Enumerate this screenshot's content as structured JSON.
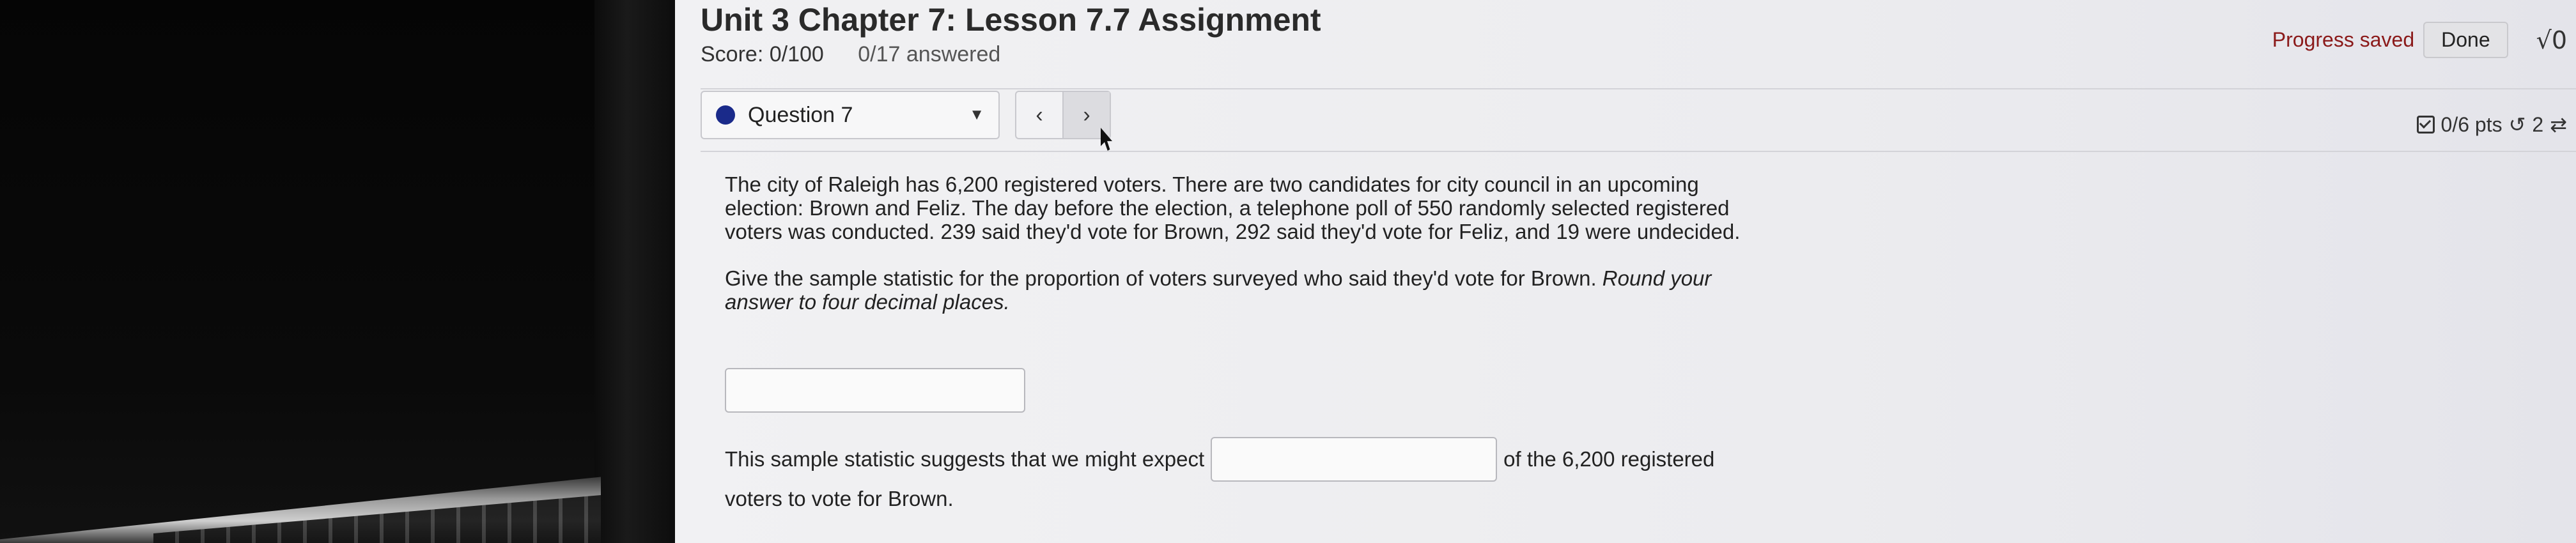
{
  "assignment": {
    "title": "Unit 3 Chapter 7: Lesson 7.7 Assignment",
    "score": "Score: 0/100",
    "answered": "0/17 answered"
  },
  "header": {
    "progress_saved": "Progress saved",
    "done_label": "Done",
    "sqrt_icon_label": "√0"
  },
  "question_nav": {
    "selected": "Question 7",
    "prev_symbol": "‹",
    "next_symbol": "›"
  },
  "points": {
    "pts": "0/6 pts",
    "retries": "2"
  },
  "question": {
    "paragraph1": "The city of Raleigh has 6,200 registered voters. There are two candidates for city council in an upcoming election: Brown and Feliz. The day before the election, a telephone poll of 550 randomly selected registered voters was conducted. 239 said they'd vote for Brown, 292 said they'd vote for Feliz, and 19 were undecided.",
    "prompt_main": "Give the sample statistic for the proportion of voters surveyed who said they'd vote for Brown. ",
    "prompt_italic": "Round your answer to four decimal places.",
    "answer1_value": "",
    "suggest_before": "This sample statistic suggests that we might expect",
    "answer2_value": "",
    "suggest_after": "of the 6,200 registered",
    "suggest_line2": "voters to vote for Brown."
  },
  "colors": {
    "status_dot": "#1a2a8a",
    "progress_saved": "#8b1a1a"
  }
}
